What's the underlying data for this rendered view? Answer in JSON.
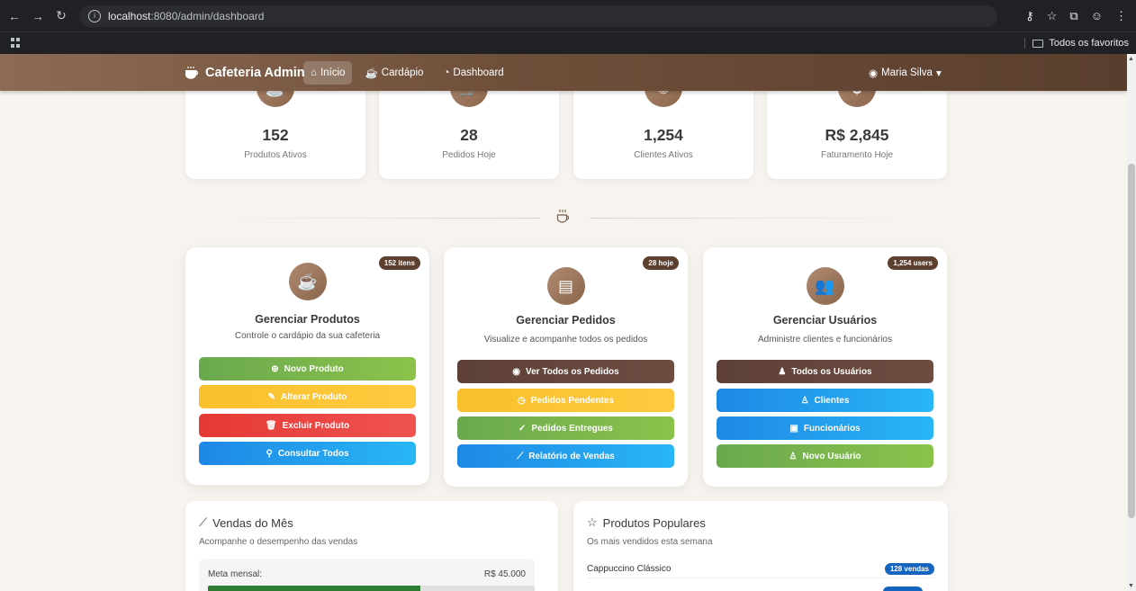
{
  "browser": {
    "url_host": "localhost",
    "url_rest": ":8080/admin/dashboard",
    "bookmark_folder": "Todos os favoritos"
  },
  "navbar": {
    "brand": "Cafeteria Admin",
    "links": [
      {
        "label": "Início",
        "active": true
      },
      {
        "label": "Cardápio",
        "active": false
      },
      {
        "label": "Dashboard",
        "active": false
      }
    ],
    "user": "Maria Silva"
  },
  "stats": [
    {
      "value": "152",
      "label": "Produtos Ativos",
      "icon": "cup-icon"
    },
    {
      "value": "28",
      "label": "Pedidos Hoje",
      "icon": "cart-icon"
    },
    {
      "value": "1,254",
      "label": "Clientes Ativos",
      "icon": "users-icon"
    },
    {
      "value": "R$ 2,845",
      "label": "Faturamento Hoje",
      "icon": "dollar-icon"
    }
  ],
  "cards": {
    "produtos": {
      "badge": "152 itens",
      "title": "Gerenciar Produtos",
      "desc": "Controle o cardápio da sua cafeteria",
      "buttons": [
        "Novo Produto",
        "Alterar Produto",
        "Excluir Produto",
        "Consultar Todos"
      ]
    },
    "pedidos": {
      "badge": "28 hoje",
      "title": "Gerenciar Pedidos",
      "desc": "Visualize e acompanhe todos os pedidos",
      "buttons": [
        "Ver Todos os Pedidos",
        "Pedidos Pendentes",
        "Pedidos Entregues",
        "Relatório de Vendas"
      ]
    },
    "usuarios": {
      "badge": "1,254 users",
      "title": "Gerenciar Usuários",
      "desc": "Administre clientes e funcionários",
      "buttons": [
        "Todos os Usuários",
        "Clientes",
        "Funcionários",
        "Novo Usuário"
      ]
    }
  },
  "vendas": {
    "title": "Vendas do Mês",
    "subtitle": "Acompanhe o desempenho das vendas",
    "meta_label": "Meta mensal:",
    "meta_value": "R$ 45.000",
    "progress_fraction": 0.65
  },
  "populares": {
    "title": "Produtos Populares",
    "subtitle": "Os mais vendidos esta semana",
    "items": [
      {
        "name": "Cappuccino Clássico",
        "badge": "128 vendas"
      }
    ]
  },
  "colors": {
    "brand_brown": "#6e4f3a",
    "green": "#6aa84f",
    "yellow": "#f9c02c",
    "red": "#e53935",
    "blue": "#1e88e5"
  }
}
